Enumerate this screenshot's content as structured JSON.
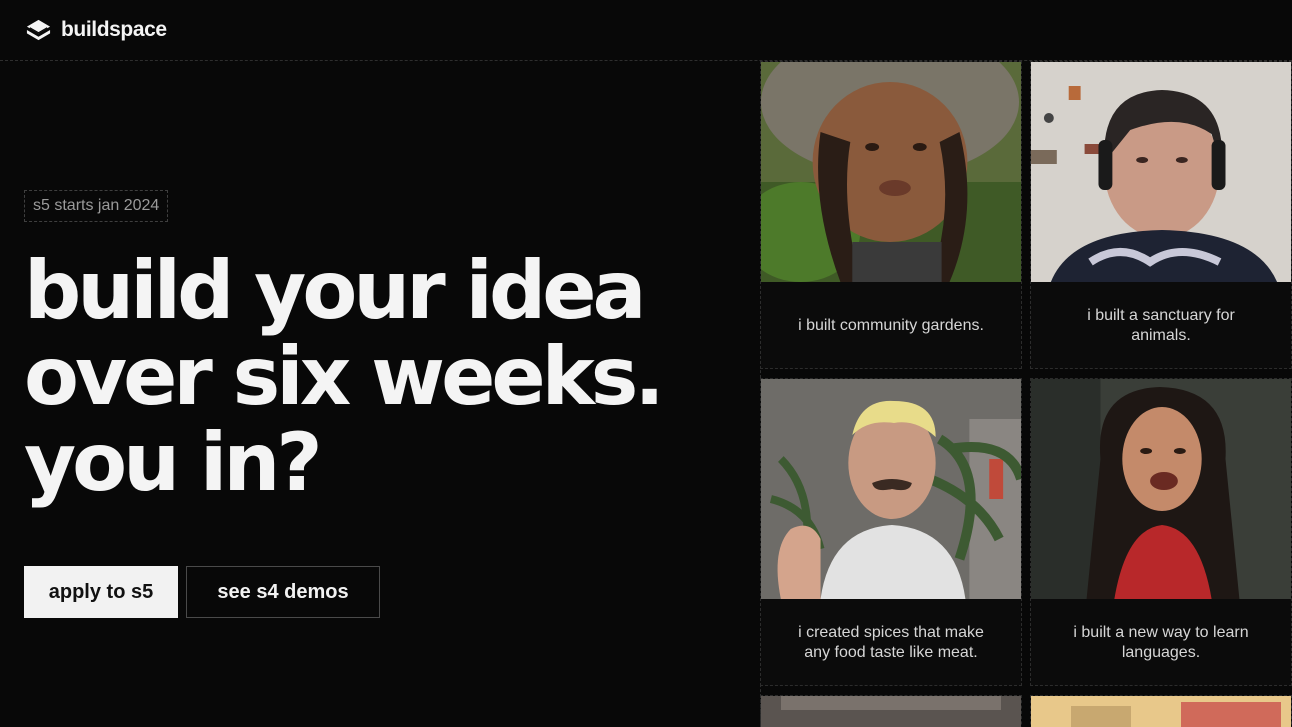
{
  "header": {
    "brand": "buildspace",
    "logo_icon": "buildspace-logo-icon"
  },
  "hero": {
    "badge": "s5 starts jan 2024",
    "headline_lines": [
      "build your idea",
      "over six weeks.",
      "you in?"
    ],
    "primary_button": "apply to s5",
    "secondary_button": "see s4 demos"
  },
  "videos": [
    {
      "caption": "i built community gardens."
    },
    {
      "caption": "i built a sanctuary for\nanimals."
    },
    {
      "caption": "i created spices that make\nany food taste like meat."
    },
    {
      "caption": "i built a new way to learn\nlanguages."
    }
  ],
  "colors": {
    "background": "#080808",
    "text": "#f2f2f2",
    "muted": "#9a9a9a",
    "primary_button_bg": "#f2f2f2"
  }
}
